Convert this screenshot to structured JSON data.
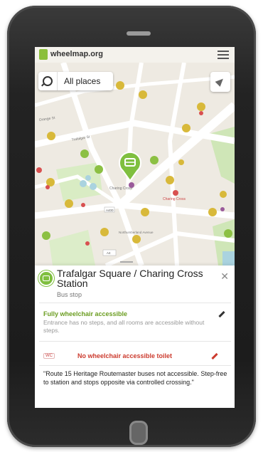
{
  "app": {
    "brand": "wheelmap.org"
  },
  "search": {
    "label": "All places"
  },
  "map": {
    "street_labels": [
      "Orange St",
      "Trafalgar St",
      "Charing Cross",
      "Charing Cross",
      "Northumberland Avenue",
      "A400",
      "A4"
    ],
    "colors": {
      "base": "#eeeae2",
      "road": "#ffffff",
      "park": "#cfe6b7",
      "water": "#aad3df",
      "marker_yellow": "#d8b93a",
      "marker_green": "#8cc043",
      "marker_bus": "#7fbf3f"
    }
  },
  "place": {
    "title": "Trafalgar Square / Charing Cross Station",
    "category": "Bus stop"
  },
  "accessibility": {
    "title": "Fully wheelchair accessible",
    "description": "Entrance has no steps, and all rooms are accessible without steps.",
    "color": "#6b9d21"
  },
  "toilet": {
    "tag": "WC",
    "text": "No wheelchair accessible toilet",
    "color": "#cc3b2e"
  },
  "note": {
    "text": "\"Route 15 Heritage Routemaster buses not accessible. Step-free to station and stops opposite via controlled crossing.\""
  },
  "icons": [
    "wheelmap-logo-icon",
    "hamburger-menu-icon",
    "search-icon",
    "locate-icon",
    "bus-icon",
    "close-icon",
    "pencil-icon"
  ]
}
